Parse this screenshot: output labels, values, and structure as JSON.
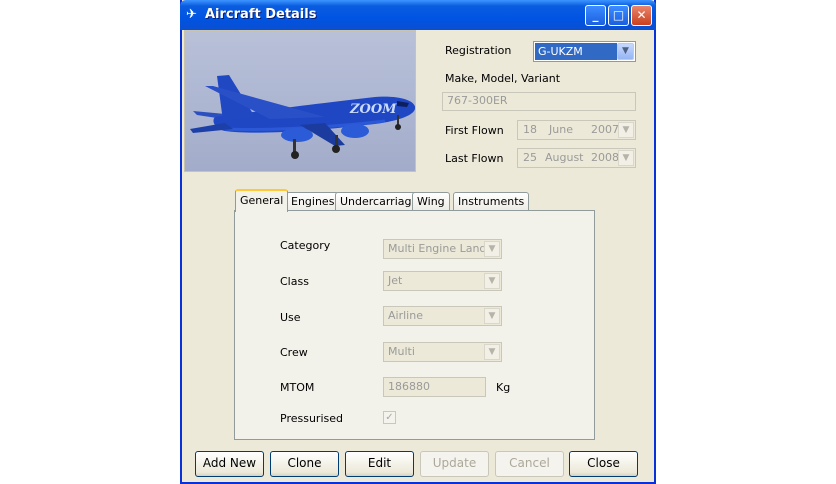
{
  "window": {
    "title": "Aircraft Details"
  },
  "top": {
    "registration_label": "Registration",
    "registration_value": "G-UKZM",
    "make_label": "Make, Model, Variant",
    "make_value": "767-300ER",
    "first_flown_label": "First Flown",
    "first_flown": {
      "day": "18",
      "month": "June",
      "year": "2007"
    },
    "last_flown_label": "Last Flown",
    "last_flown": {
      "day": "25",
      "month": "August",
      "year": "2008"
    },
    "photo_livery_text": "ZOOM"
  },
  "tabs": [
    "General",
    "Engines",
    "Undercarriage",
    "Wing",
    "Instruments"
  ],
  "general": {
    "category_label": "Category",
    "category_value": "Multi Engine Land",
    "class_label": "Class",
    "class_value": "Jet",
    "use_label": "Use",
    "use_value": "Airline",
    "crew_label": "Crew",
    "crew_value": "Multi",
    "mtom_label": "MTOM",
    "mtom_value": "186880",
    "mtom_unit": "Kg",
    "pressurised_label": "Pressurised"
  },
  "buttons": {
    "add_new": "Add New",
    "clone": "Clone",
    "edit": "Edit",
    "update": "Update",
    "cancel": "Cancel",
    "close": "Close"
  },
  "colors": {
    "title_bar": "#0054e3",
    "selection": "#316ac5",
    "window_bg": "#ece9d8",
    "aircraft_livery": "#1f47c4"
  }
}
